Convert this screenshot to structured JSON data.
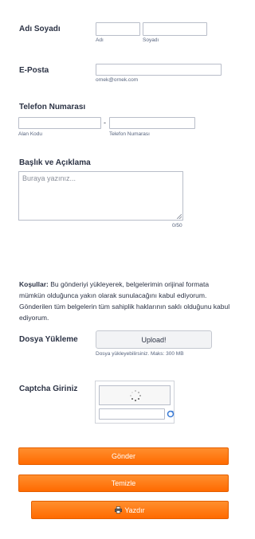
{
  "name_field": {
    "label": "Adı Soyadı",
    "first_sublabel": "Adı",
    "last_sublabel": "Soyadı",
    "first_value": "",
    "last_value": ""
  },
  "email_field": {
    "label": "E-Posta",
    "sublabel": "ornek@ornek.com",
    "value": ""
  },
  "phone_field": {
    "label": "Telefon Numarası",
    "separator": "-",
    "area_sublabel": "Alan Kodu",
    "number_sublabel": "Telefon Numarası"
  },
  "description_field": {
    "label": "Başlık ve Açıklama",
    "placeholder": "Buraya yazınız...",
    "counter": "0/50"
  },
  "terms": {
    "bold": "Koşullar:",
    "text": " Bu gönderiyi yükleyerek, belgelerimin orijinal formata mümkün olduğunca yakın olarak sunulacağını kabul ediyorum. Gönderilen tüm belgelerin tüm sahiplik haklarının saklı olduğunu kabul ediyorum."
  },
  "upload_field": {
    "label": "Dosya Yükleme",
    "button_label": "Upload!",
    "hint": "Dosya yükleyebilirsiniz. Maks: 300 MB"
  },
  "captcha_field": {
    "label": "Captcha Giriniz",
    "refresh_icon": "refresh-icon",
    "loading_icon": "spinner-icon"
  },
  "buttons": {
    "submit_label": "Gönder",
    "clear_label": "Temizle",
    "print_label": "Yazdır",
    "print_icon": "printer-icon"
  },
  "colors": {
    "accent": "#ff6a00",
    "text": "#2c3345",
    "border": "#b8bdc9"
  }
}
